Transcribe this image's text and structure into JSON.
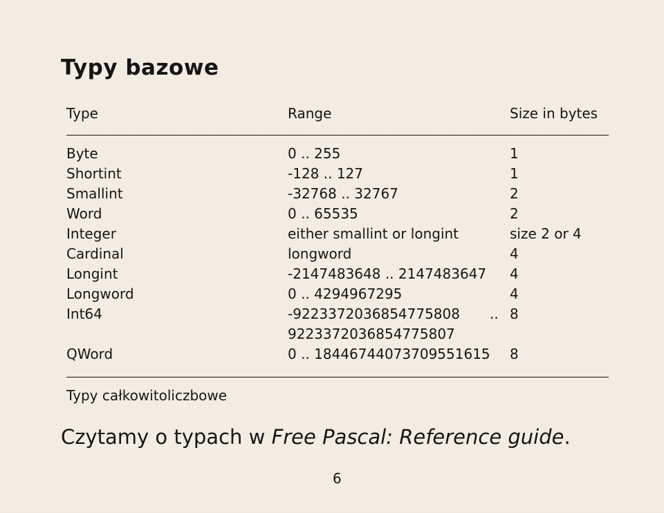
{
  "title": "Typy bazowe",
  "table": {
    "headers": {
      "type": "Type",
      "range": "Range",
      "size": "Size in bytes"
    },
    "rows": [
      {
        "type": "Byte",
        "range": "0 .. 255",
        "size": "1"
      },
      {
        "type": "Shortint",
        "range": "-128 .. 127",
        "size": "1"
      },
      {
        "type": "Smallint",
        "range": "-32768 .. 32767",
        "size": "2"
      },
      {
        "type": "Word",
        "range": "0 .. 65535",
        "size": "2"
      },
      {
        "type": "Integer",
        "range": "either smallint or longint",
        "size": "size 2 or 4"
      },
      {
        "type": "Cardinal",
        "range": "longword",
        "size": "4"
      },
      {
        "type": "Longint",
        "range": "-2147483648 .. 2147483647",
        "size": "4"
      },
      {
        "type": "Longword",
        "range": "0 .. 4294967295",
        "size": "4"
      },
      {
        "type": "Int64",
        "range": "-9223372036854775808",
        "range_sep": "..",
        "range_cont": "9223372036854775807",
        "size": "8"
      },
      {
        "type": "QWord",
        "range": "0 .. 18446744073709551615",
        "size": "8"
      }
    ],
    "caption": "Typy całkowitoliczbowe"
  },
  "note": {
    "prefix": "Czytamy o typach w ",
    "italic": "Free Pascal: Reference guide",
    "suffix": "."
  },
  "page_number": "6"
}
